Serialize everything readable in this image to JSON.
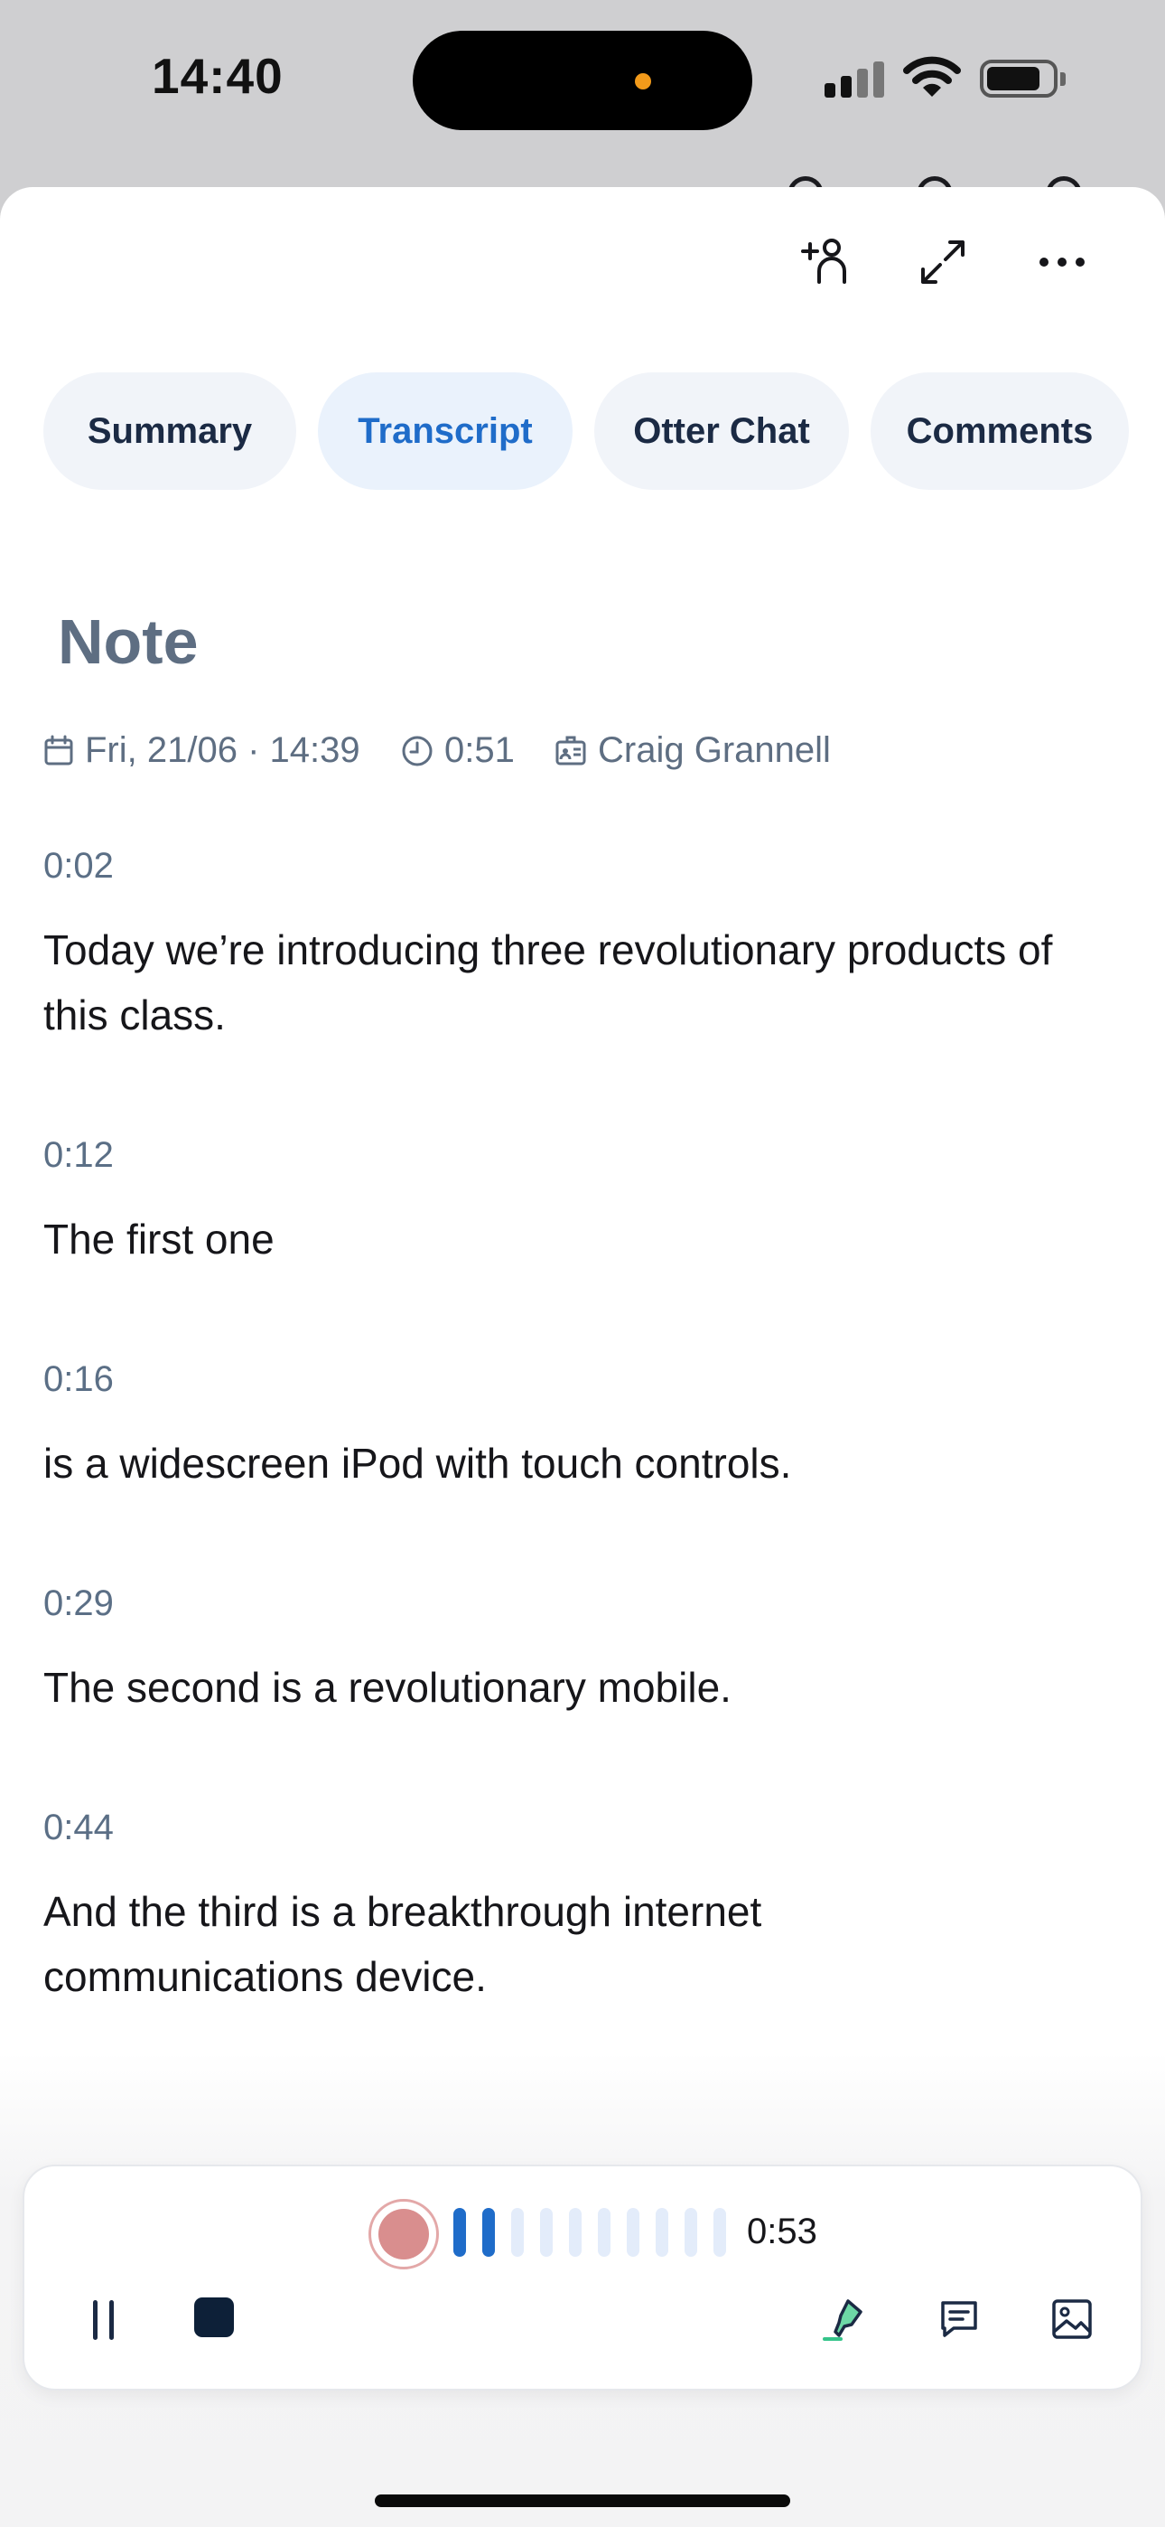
{
  "status_bar": {
    "time": "14:40"
  },
  "tabs": [
    {
      "label": "Summary",
      "active": false
    },
    {
      "label": "Transcript",
      "active": true
    },
    {
      "label": "Otter Chat",
      "active": false
    },
    {
      "label": "Comments",
      "active": false
    }
  ],
  "note": {
    "title": "Note",
    "date": "Fri, 21/06 · 14:39",
    "duration": "0:51",
    "owner": "Craig Grannell"
  },
  "transcript": [
    {
      "time": "0:02",
      "text": "Today we’re introducing three revolutionary products of this class."
    },
    {
      "time": "0:12",
      "text": "The first one"
    },
    {
      "time": "0:16",
      "text": "is a widescreen iPod with touch controls."
    },
    {
      "time": "0:29",
      "text": "The second is a revolutionary mobile."
    },
    {
      "time": "0:44",
      "text": "And the third is a breakthrough internet communications device."
    }
  ],
  "player": {
    "elapsed": "0:53",
    "recording": true,
    "level_bars_total": 10,
    "level_bars_active": 2
  },
  "colors": {
    "accent": "#1f6cc9",
    "tab_bg": "#f1f4f9",
    "timestamp": "#5b6f86",
    "record": "#d98e8e"
  },
  "icons": [
    "add-person-icon",
    "expand-icon",
    "more-icon",
    "calendar-icon",
    "clock-icon",
    "owner-badge-icon",
    "pause-icon",
    "stop-icon",
    "highlighter-icon",
    "comment-icon",
    "image-icon"
  ]
}
